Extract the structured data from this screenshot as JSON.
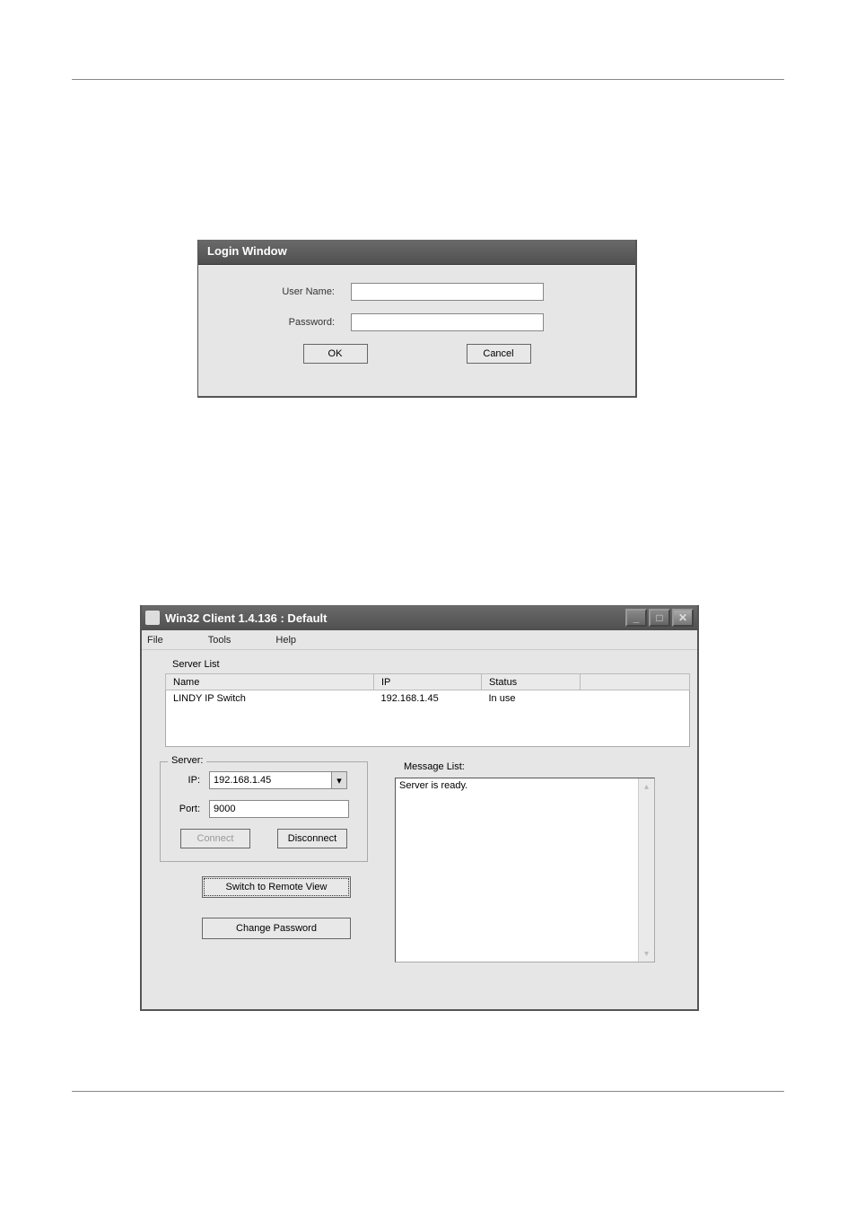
{
  "login": {
    "title": "Login Window",
    "username_label": "User Name:",
    "password_label": "Password:",
    "username_value": "",
    "password_value": "",
    "ok": "OK",
    "cancel": "Cancel"
  },
  "client": {
    "title": "Win32 Client 1.4.136 : Default",
    "menu": {
      "file": "File",
      "tools": "Tools",
      "help": "Help"
    },
    "server_list_label": "Server List",
    "table": {
      "headers": {
        "name": "Name",
        "ip": "IP",
        "status": "Status"
      },
      "rows": [
        {
          "name": "LINDY IP Switch",
          "ip": "192.168.1.45",
          "status": "In use"
        }
      ]
    },
    "server_group": {
      "legend": "Server:",
      "ip_label": "IP:",
      "ip_value": "192.168.1.45",
      "port_label": "Port:",
      "port_value": "9000",
      "connect": "Connect",
      "disconnect": "Disconnect"
    },
    "switch_remote": "Switch to Remote View",
    "change_password": "Change Password",
    "message_list_label": "Message List:",
    "message_text": "Server is ready."
  }
}
